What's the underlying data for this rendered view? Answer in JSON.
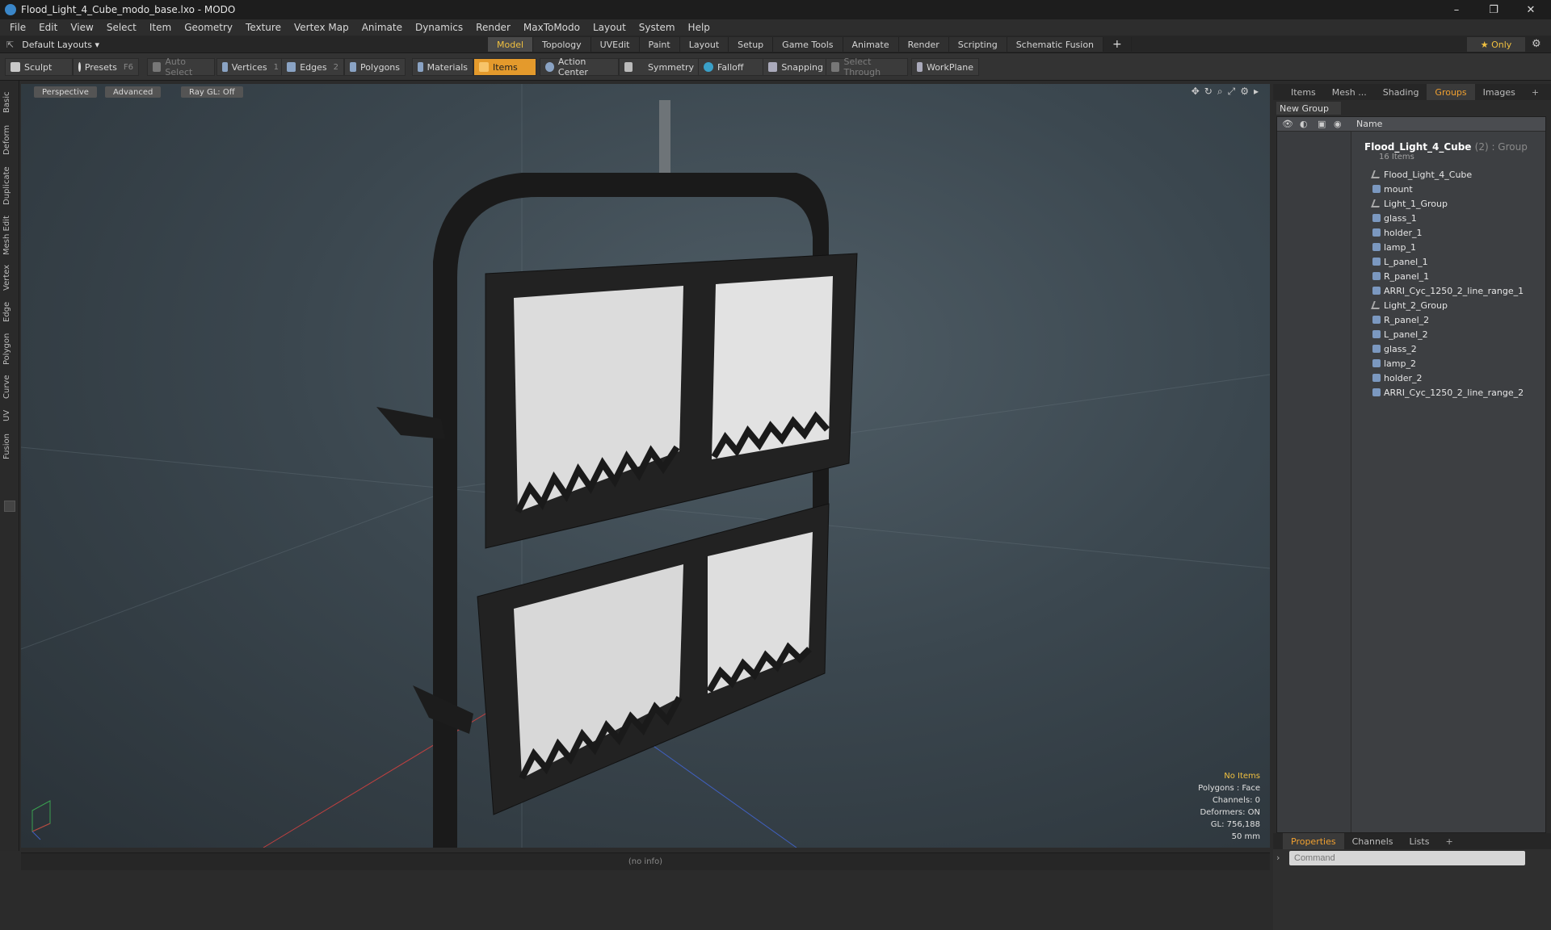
{
  "window": {
    "title": "Flood_Light_4_Cube_modo_base.lxo - MODO",
    "controls": [
      "–",
      "❐",
      "✕"
    ]
  },
  "menubar": [
    "File",
    "Edit",
    "View",
    "Select",
    "Item",
    "Geometry",
    "Texture",
    "Vertex Map",
    "Animate",
    "Dynamics",
    "Render",
    "MaxToModo",
    "Layout",
    "System",
    "Help"
  ],
  "layout": {
    "selector": "Default Layouts ▾",
    "tabs": [
      "Model",
      "Topology",
      "UVEdit",
      "Paint",
      "Layout",
      "Setup",
      "Game Tools",
      "Animate",
      "Render",
      "Scripting",
      "Schematic Fusion"
    ],
    "active_tab": "Model",
    "only_label": "★ Only"
  },
  "toolbar": {
    "sculpt": "Sculpt",
    "presets": "Presets",
    "presets_key": "F6",
    "auto_select": "Auto Select",
    "vertices": "Vertices",
    "vertices_key": "1",
    "edges": "Edges",
    "edges_key": "2",
    "polygons": "Polygons",
    "materials": "Materials",
    "items": "Items",
    "action_center": "Action Center",
    "symmetry": "Symmetry",
    "falloff": "Falloff",
    "snapping": "Snapping",
    "select_through": "Select Through",
    "workplane": "WorkPlane"
  },
  "left_tabs": [
    "Basic",
    "Deform",
    "Duplicate",
    "Mesh Edit",
    "Vertex",
    "Edge",
    "Polygon",
    "Curve",
    "UV",
    "Fusion"
  ],
  "viewport": {
    "view_mode": "Perspective",
    "shading": "Advanced",
    "raygl": "Ray GL: Off",
    "info": {
      "selection": "No Items",
      "polygons": "Polygons : Face",
      "channels": "Channels: 0",
      "deformers": "Deformers: ON",
      "gl": "GL: 756,188",
      "focal": "50 mm"
    }
  },
  "statusbar": "(no info)",
  "right_panel": {
    "tabs": [
      "Items",
      "Mesh ...",
      "Shading",
      "Groups",
      "Images"
    ],
    "active_tab": "Groups",
    "new_group": "New Group",
    "column_name": "Name",
    "group": {
      "name": "Flood_Light_4_Cube",
      "suffix": "(2) : Group",
      "count": "16 Items"
    },
    "items": [
      "Flood_Light_4_Cube",
      "mount",
      "Light_1_Group",
      "glass_1",
      "holder_1",
      "lamp_1",
      "L_panel_1",
      "R_panel_1",
      "ARRI_Cyc_1250_2_line_range_1",
      "Light_2_Group",
      "R_panel_2",
      "L_panel_2",
      "glass_2",
      "lamp_2",
      "holder_2",
      "ARRI_Cyc_1250_2_line_range_2"
    ],
    "bottom_tabs": [
      "Properties",
      "Channels",
      "Lists"
    ],
    "bottom_active": "Properties",
    "command_placeholder": "Command"
  }
}
